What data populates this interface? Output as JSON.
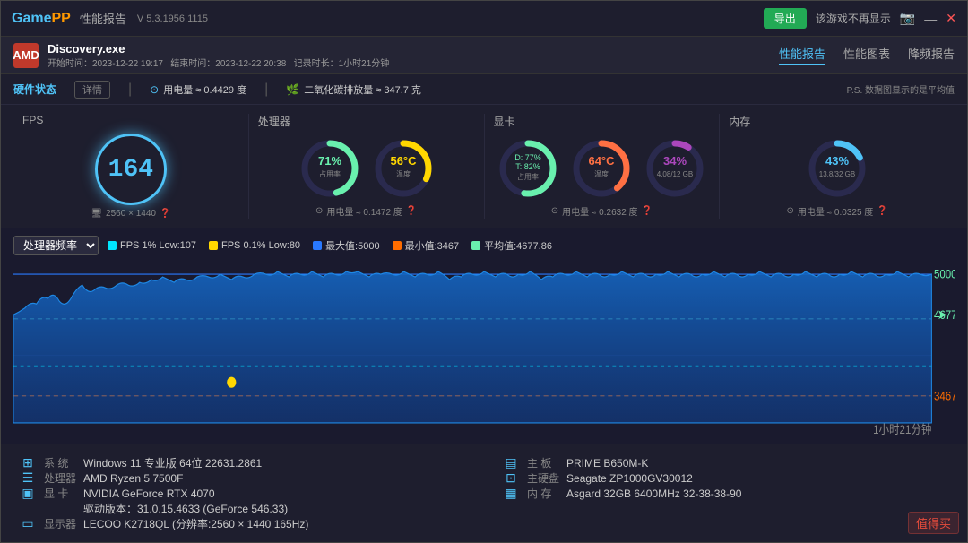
{
  "titlebar": {
    "logo_game": "Game",
    "logo_pp": "PP",
    "title": "性能报告",
    "version": "V 5.3.1956.1115",
    "export_label": "导出",
    "no_show_label": "该游戏不再显示",
    "minimize": "—",
    "close": "✕"
  },
  "appbar": {
    "app_icon": "AMD",
    "app_name": "Discovery.exe",
    "start_label": "开始时间：2023-12-22 19:17",
    "end_label": "结束时间：2023-12-22 20:38",
    "duration_label": "记录时长：1小时21分钟",
    "tabs": [
      {
        "label": "性能报告",
        "active": true
      },
      {
        "label": "性能图表",
        "active": false
      },
      {
        "label": "降频报告",
        "active": false
      }
    ]
  },
  "hwbar": {
    "title": "硬件状态",
    "detail_btn": "详情",
    "power_label": "用电量 ≈ 0.4429 度",
    "co2_label": "二氧化碳排放量 ≈ 347.7 克",
    "ps_note": "P.S. 数据图显示的是平均值"
  },
  "metrics": {
    "fps": {
      "label": "FPS",
      "value": "164",
      "resolution": "2560 × 1440"
    },
    "cpu": {
      "label": "处理器",
      "usage_pct": 71,
      "usage_label": "71%",
      "usage_sub": "占用率",
      "temp_val": "56°C",
      "temp_sub": "温度",
      "power_label": "用电量 ≈ 0.1472 度"
    },
    "gpu": {
      "label": "显卡",
      "usage_d": 77,
      "usage_t": 82,
      "usage_label": "D: 77%\nT: 82%",
      "usage_sub": "占用率",
      "temp_val": "64°C",
      "temp_sub": "温度",
      "vram_pct": 34,
      "vram_label": "34%",
      "vram_sub": "4.08/12 GB",
      "power_label": "用电量 ≈ 0.2632 度"
    },
    "ram": {
      "label": "内存",
      "usage_pct": 43,
      "usage_label": "43%",
      "usage_sub": "13.8/32 GB",
      "power_label": "用电量 ≈ 0.0325 度"
    }
  },
  "chart": {
    "select_label": "处理器频率",
    "dropdown_label": "▼",
    "legend": [
      {
        "color": "#00e5ff",
        "label": "FPS 1% Low:107"
      },
      {
        "color": "#ffd700",
        "label": "FPS 0.1% Low:80"
      },
      {
        "color": "#2979ff",
        "label": "最大值:5000"
      },
      {
        "color": "#ff6d00",
        "label": "最小值:3467"
      },
      {
        "color": "#69f0ae",
        "label": "平均值:4677.86"
      }
    ],
    "y_max": "5000",
    "y_avg": "4677.86",
    "y_min": "3467",
    "x_label": "1小时21分钟"
  },
  "sysinfo": {
    "left": [
      {
        "icon": "system",
        "key": "系 统",
        "val": "Windows 11 专业版 64位 22631.2861"
      },
      {
        "icon": "cpu",
        "key": "处理器",
        "val": "AMD Ryzen 5 7500F"
      },
      {
        "icon": "gpu",
        "key": "显 卡",
        "val": "NVIDIA GeForce RTX 4070"
      },
      {
        "icon": "gpu_driver",
        "key": "",
        "val": "驱动版本：31.0.15.4633 (GeForce 546.33)"
      },
      {
        "icon": "monitor",
        "key": "显示器",
        "val": "LECOO K2718QL (分辨率:2560 × 1440 165Hz)"
      }
    ],
    "right": [
      {
        "icon": "mobo",
        "key": "主 板",
        "val": "PRIME B650M-K"
      },
      {
        "icon": "hdd",
        "key": "主硬盘",
        "val": "Seagate ZP1000GV30012"
      },
      {
        "icon": "ram",
        "key": "内 存",
        "val": "Asgard 32GB 6400MHz 32-38-38-90"
      },
      {
        "icon": "",
        "key": "",
        "val": ""
      },
      {
        "icon": "",
        "key": "",
        "val": ""
      }
    ]
  },
  "watermark": "值得买"
}
